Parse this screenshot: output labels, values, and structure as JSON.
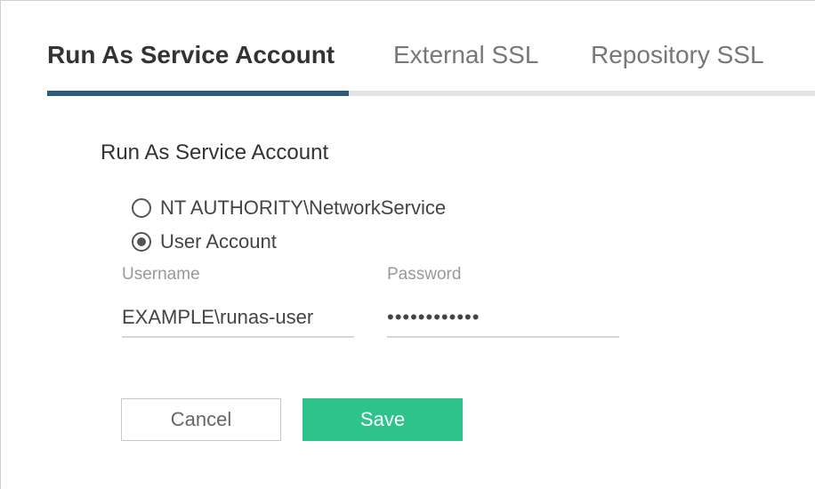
{
  "tabs": [
    {
      "label": "Run As Service Account",
      "active": true
    },
    {
      "label": "External SSL",
      "active": false
    },
    {
      "label": "Repository SSL",
      "active": false
    }
  ],
  "section": {
    "title": "Run As Service Account"
  },
  "account_options": [
    {
      "label": "NT AUTHORITY\\NetworkService",
      "selected": false
    },
    {
      "label": "User Account",
      "selected": true
    }
  ],
  "fields": {
    "username": {
      "label": "Username",
      "value": "EXAMPLE\\runas-user"
    },
    "password": {
      "label": "Password",
      "value": "••••••••••••"
    }
  },
  "buttons": {
    "cancel_label": "Cancel",
    "save_label": "Save"
  },
  "colors": {
    "accent_tab": "#2f5a7a",
    "save_button": "#2ec38b"
  }
}
